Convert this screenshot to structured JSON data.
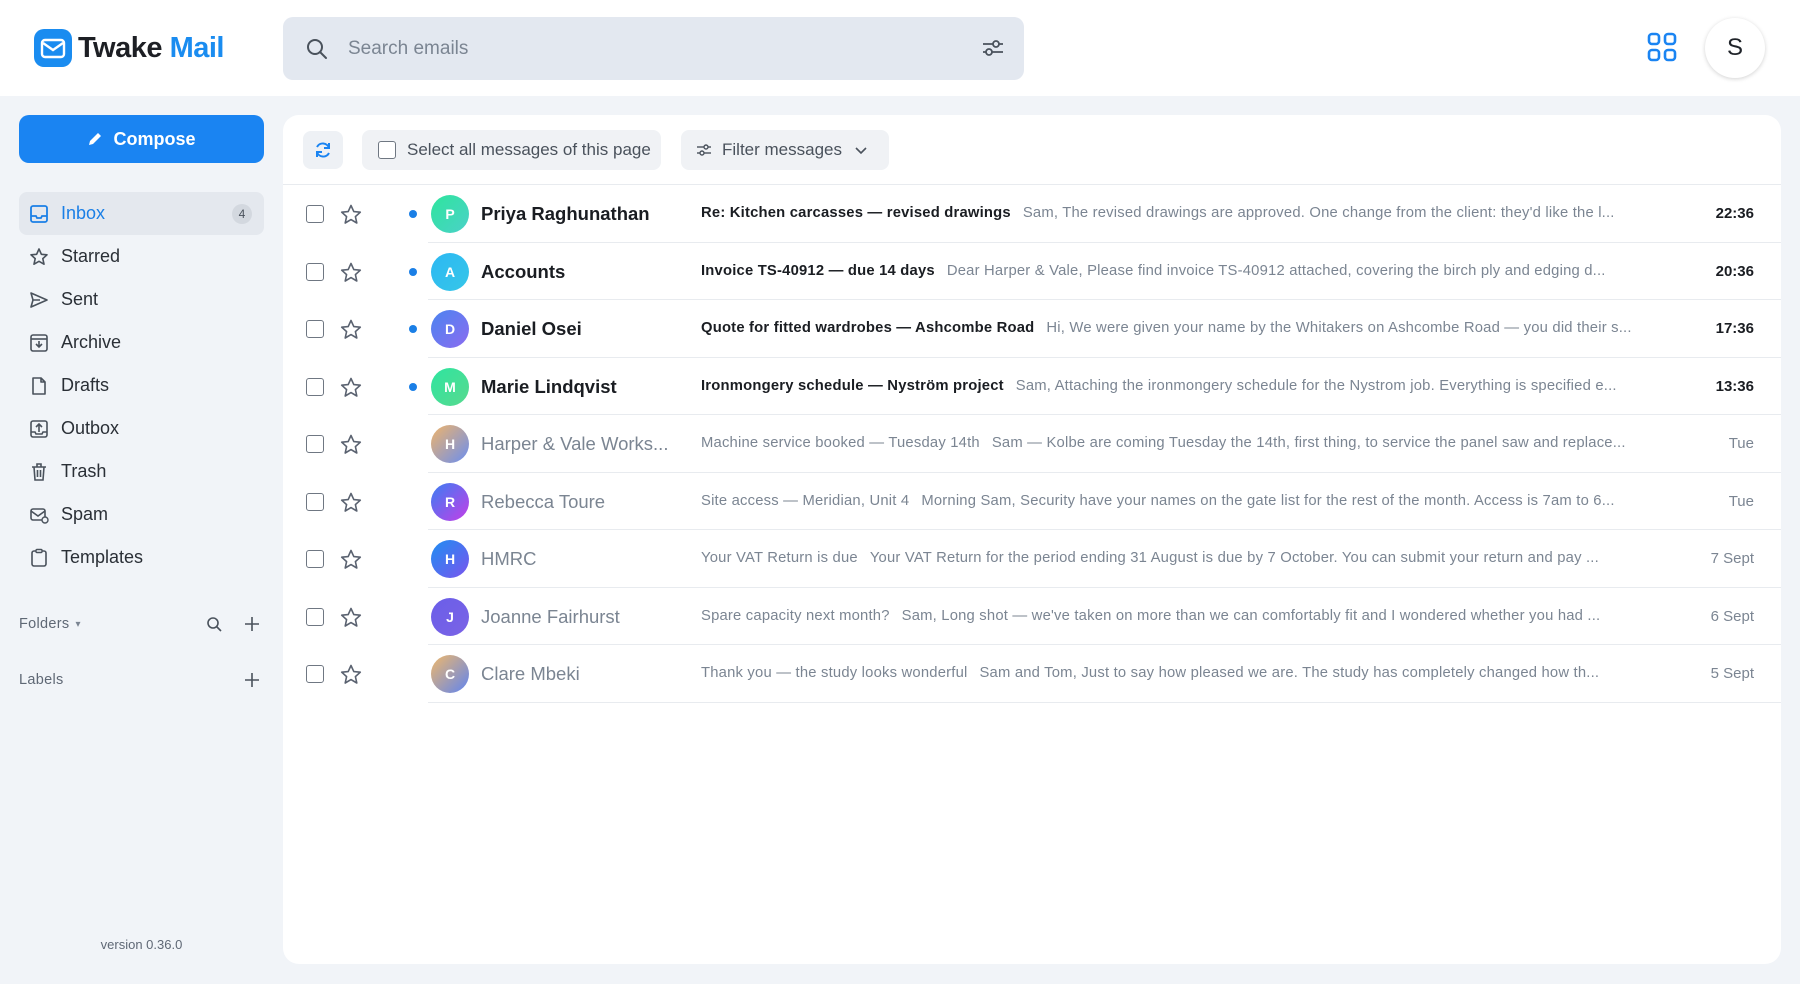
{
  "app": {
    "name_main": "Twake",
    "name_accent": "Mail",
    "user_initial": "S",
    "version": "version 0.36.0"
  },
  "search": {
    "placeholder": "Search emails"
  },
  "compose": {
    "label": "Compose"
  },
  "nav": [
    {
      "label": "Inbox",
      "icon": "inbox-icon",
      "badge": "4",
      "active": true
    },
    {
      "label": "Starred",
      "icon": "star-icon"
    },
    {
      "label": "Sent",
      "icon": "send-icon"
    },
    {
      "label": "Archive",
      "icon": "archive-icon"
    },
    {
      "label": "Drafts",
      "icon": "draft-icon"
    },
    {
      "label": "Outbox",
      "icon": "outbox-icon"
    },
    {
      "label": "Trash",
      "icon": "trash-icon"
    },
    {
      "label": "Spam",
      "icon": "spam-icon"
    },
    {
      "label": "Templates",
      "icon": "template-icon"
    }
  ],
  "sections": {
    "folders": "Folders",
    "labels": "Labels"
  },
  "toolbar": {
    "select_all": "Select all messages of this page",
    "filter": "Filter messages"
  },
  "colors": {
    "accent": "#1a84f2",
    "unread_dot": "#1a7fe6"
  },
  "emails": [
    {
      "initial": "P",
      "sender": "Priya Raghunathan",
      "subject": "Re: Kitchen carcasses — revised drawings",
      "preview": "Sam, The revised drawings are approved. One change from the client: they'd like the l...",
      "time": "22:36",
      "unread": true,
      "avatar_colors": [
        "#2ee59d",
        "#4bd1c8"
      ]
    },
    {
      "initial": "A",
      "sender": "Accounts",
      "subject": "Invoice TS-40912 — due 14 days",
      "preview": "Dear Harper & Vale, Please find invoice TS-40912 attached, covering the birch ply and edging d...",
      "time": "20:36",
      "unread": true,
      "avatar_colors": [
        "#2cb8f3",
        "#36c6e8"
      ]
    },
    {
      "initial": "D",
      "sender": "Daniel Osei",
      "subject": "Quote for fitted wardrobes — Ashcombe Road",
      "preview": "Hi, We were given your name by the Whitakers on Ashcombe Road — you did their s...",
      "time": "17:36",
      "unread": true,
      "avatar_colors": [
        "#4b84f0",
        "#8b6cf0"
      ]
    },
    {
      "initial": "M",
      "sender": "Marie Lindqvist",
      "subject": "Ironmongery schedule — Nyström project",
      "preview": "Sam, Attaching the ironmongery schedule for the Nystrom job. Everything is specified e...",
      "time": "13:36",
      "unread": true,
      "avatar_colors": [
        "#2ee5a0",
        "#58d98f"
      ]
    },
    {
      "initial": "H",
      "sender": "Harper & Vale Works...",
      "subject": "Machine service booked — Tuesday 14th",
      "preview": "Sam — Kolbe are coming Tuesday the 14th, first thing, to service the panel saw and replace...",
      "time": "Tue",
      "unread": false,
      "avatar_colors": [
        "#f0b46a",
        "#6a8ef0"
      ]
    },
    {
      "initial": "R",
      "sender": "Rebecca Toure",
      "subject": "Site access — Meridian, Unit 4",
      "preview": "Morning Sam, Security have your names on the gate list for the rest of the month. Access is 7am to 6...",
      "time": "Tue",
      "unread": false,
      "avatar_colors": [
        "#3a7ef2",
        "#c43ee8"
      ]
    },
    {
      "initial": "H",
      "sender": "HMRC",
      "subject": "Your VAT Return is due",
      "preview": "Your VAT Return for the period ending 31 August is due by 7 October. You can submit your return and pay ...",
      "time": "7 Sept",
      "unread": false,
      "avatar_colors": [
        "#1e8ef2",
        "#7a55ee"
      ]
    },
    {
      "initial": "J",
      "sender": "Joanne Fairhurst",
      "subject": "Spare capacity next month?",
      "preview": "Sam, Long shot — we've taken on more than we can comfortably fit and I wondered whether you had ...",
      "time": "6 Sept",
      "unread": false,
      "avatar_colors": [
        "#6a5ee8",
        "#7b63e6"
      ]
    },
    {
      "initial": "C",
      "sender": "Clare Mbeki",
      "subject": "Thank you — the study looks wonderful",
      "preview": "Sam and Tom, Just to say how pleased we are. The study has completely changed how th...",
      "time": "5 Sept",
      "unread": false,
      "avatar_colors": [
        "#f0b86a",
        "#5f84f0"
      ]
    }
  ]
}
